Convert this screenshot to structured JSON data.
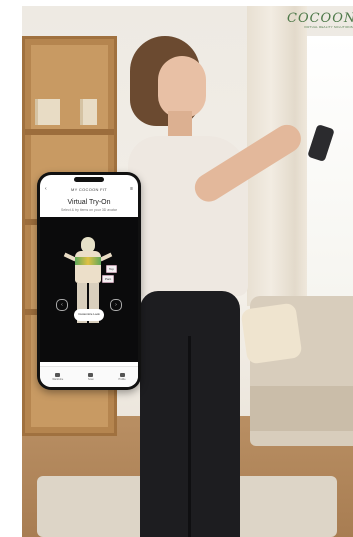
{
  "logo": {
    "wordmark": "COCOON",
    "tagline": "VIRTUAL REALITY SOLUTIONS"
  },
  "app": {
    "header_title": "MY COCOON FIT",
    "screen_title": "Virtual Try-On",
    "screen_subtitle": "Select & try items on your 3D avatar",
    "tags": [
      "Top",
      "Pant"
    ],
    "center_button": "Customize Look",
    "tabs": [
      {
        "label": "Wardrobe",
        "icon": "hanger-icon"
      },
      {
        "label": "Scan",
        "icon": "scan-icon"
      },
      {
        "label": "Profile",
        "icon": "person-icon"
      }
    ]
  },
  "colors": {
    "brand_green": "#4f7a4a",
    "leggings": "#1d1d20",
    "viewer_bg": "#0b0b0c"
  }
}
